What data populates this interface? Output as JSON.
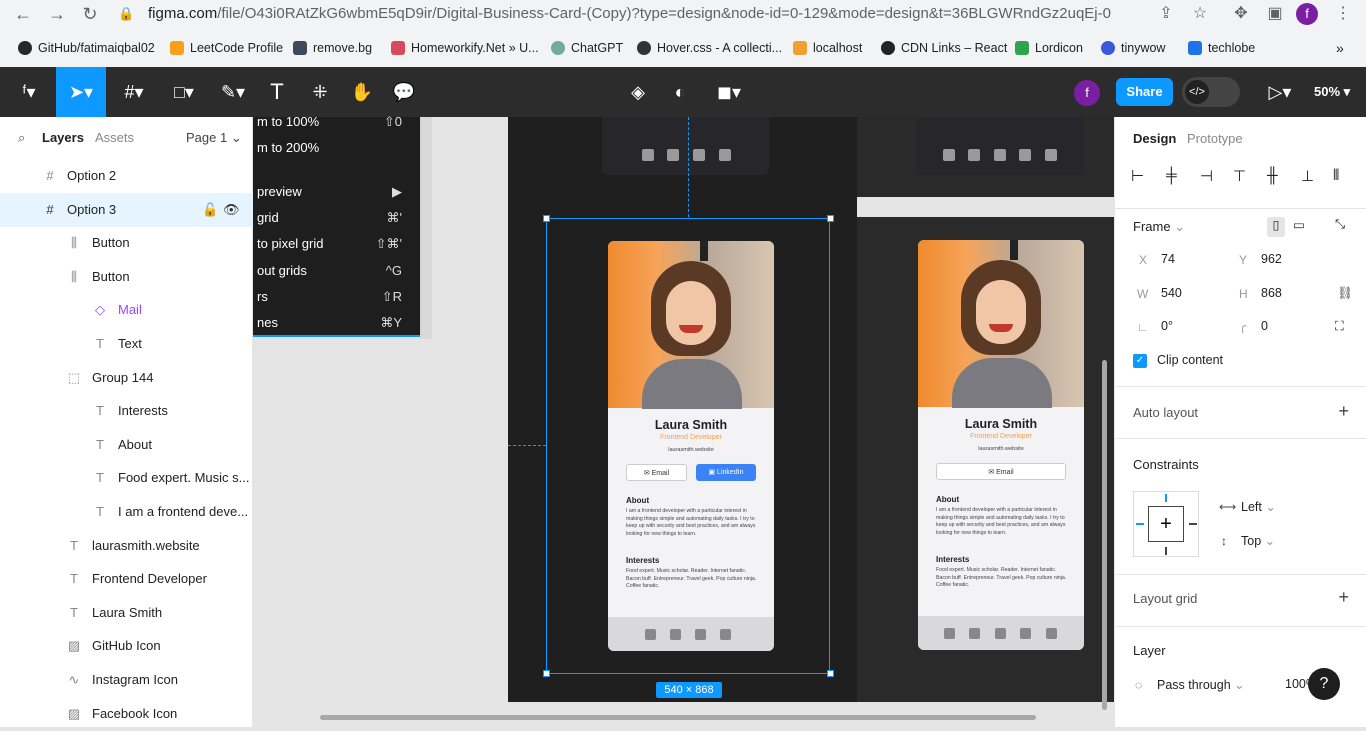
{
  "browser": {
    "url_host": "figma.com",
    "url_path": "/file/O43i0RAtZkG6wbmE5qD9ir/Digital-Business-Card-(Copy)?type=design&node-id=0-129&mode=design&t=36BLGWRndGz2uqEj-0",
    "profile_letter": "f",
    "bookmarks": [
      "GitHub/fatimaiqbal02",
      "LeetCode Profile",
      "remove.bg",
      "Homeworkify.Net » U...",
      "ChatGPT",
      "Hover.css - A collecti...",
      "localhost",
      "CDN Links – React",
      "Lordicon",
      "tinywow",
      "techlobe"
    ]
  },
  "toolbar": {
    "share_label": "Share",
    "zoom": "50%",
    "avatar_letter": "f"
  },
  "left_panel": {
    "tabs": [
      "Layers",
      "Assets"
    ],
    "page": "Page 1",
    "layers": [
      {
        "name": "Option 2",
        "icon": "frame-icon"
      },
      {
        "name": "Option 3",
        "icon": "frame-icon"
      },
      {
        "name": "Button",
        "icon": "auto-layout-icon"
      },
      {
        "name": "Button",
        "icon": "auto-layout-icon"
      },
      {
        "name": "Mail",
        "icon": "component-icon"
      },
      {
        "name": "Text",
        "icon": "text-icon"
      },
      {
        "name": "Group 144",
        "icon": "group-icon"
      },
      {
        "name": "Interests",
        "icon": "text-icon"
      },
      {
        "name": "About",
        "icon": "text-icon"
      },
      {
        "name": "Food expert. Music s...",
        "icon": "text-icon"
      },
      {
        "name": "I am a frontend deve...",
        "icon": "text-icon"
      },
      {
        "name": "laurasmith.website",
        "icon": "text-icon"
      },
      {
        "name": "Frontend Developer",
        "icon": "text-icon"
      },
      {
        "name": "Laura Smith",
        "icon": "text-icon"
      },
      {
        "name": "GitHub Icon",
        "icon": "image-icon"
      },
      {
        "name": "Instagram Icon",
        "icon": "vector-icon"
      },
      {
        "name": "Facebook Icon",
        "icon": "image-icon"
      }
    ]
  },
  "menu": {
    "items": [
      {
        "label": "m to 100%",
        "shortcut": "⇧0"
      },
      {
        "label": "m to 200%",
        "shortcut": ""
      },
      {
        "label": " preview",
        "shortcut": "▶"
      },
      {
        "label": " grid",
        "shortcut": "⌘'"
      },
      {
        "label": " to pixel grid",
        "shortcut": "⇧⌘'"
      },
      {
        "label": "out grids",
        "shortcut": "^G"
      },
      {
        "label": "rs",
        "shortcut": "⇧R"
      },
      {
        "label": "nes",
        "shortcut": "⌘Y"
      }
    ]
  },
  "canvas": {
    "dims_label": "540 × 868",
    "card": {
      "name": "Laura Smith",
      "role": "Frontend Developer",
      "site": "laurasmith.website",
      "email_btn": "Email",
      "linkedin_btn": "LinkedIn",
      "about_title": "About",
      "about_text": "I am a frontend developer with a particular interest in making things simple and automating daily tasks. I try to keep up with security and best practices, and am always looking for new things to learn.",
      "interests_title": "Interests",
      "interests_text": "Food expert. Music scholar. Reader. Internet fanatic. Bacon buff. Entrepreneur. Travel geek. Pop culture ninja. Coffee fanatic."
    }
  },
  "right_panel": {
    "tabs": [
      "Design",
      "Prototype"
    ],
    "frame_label": "Frame",
    "x_label": "X",
    "x": "74",
    "y_label": "Y",
    "y": "962",
    "w_label": "W",
    "w": "540",
    "h_label": "H",
    "h": "868",
    "rotation": "0°",
    "radius": "0",
    "clip_content": "Clip content",
    "auto_layout": "Auto layout",
    "constraints": "Constraints",
    "constraint_h": "Left",
    "constraint_v": "Top",
    "layout_grid": "Layout grid",
    "layer": "Layer",
    "blend": "Pass through",
    "opacity": "100%"
  }
}
